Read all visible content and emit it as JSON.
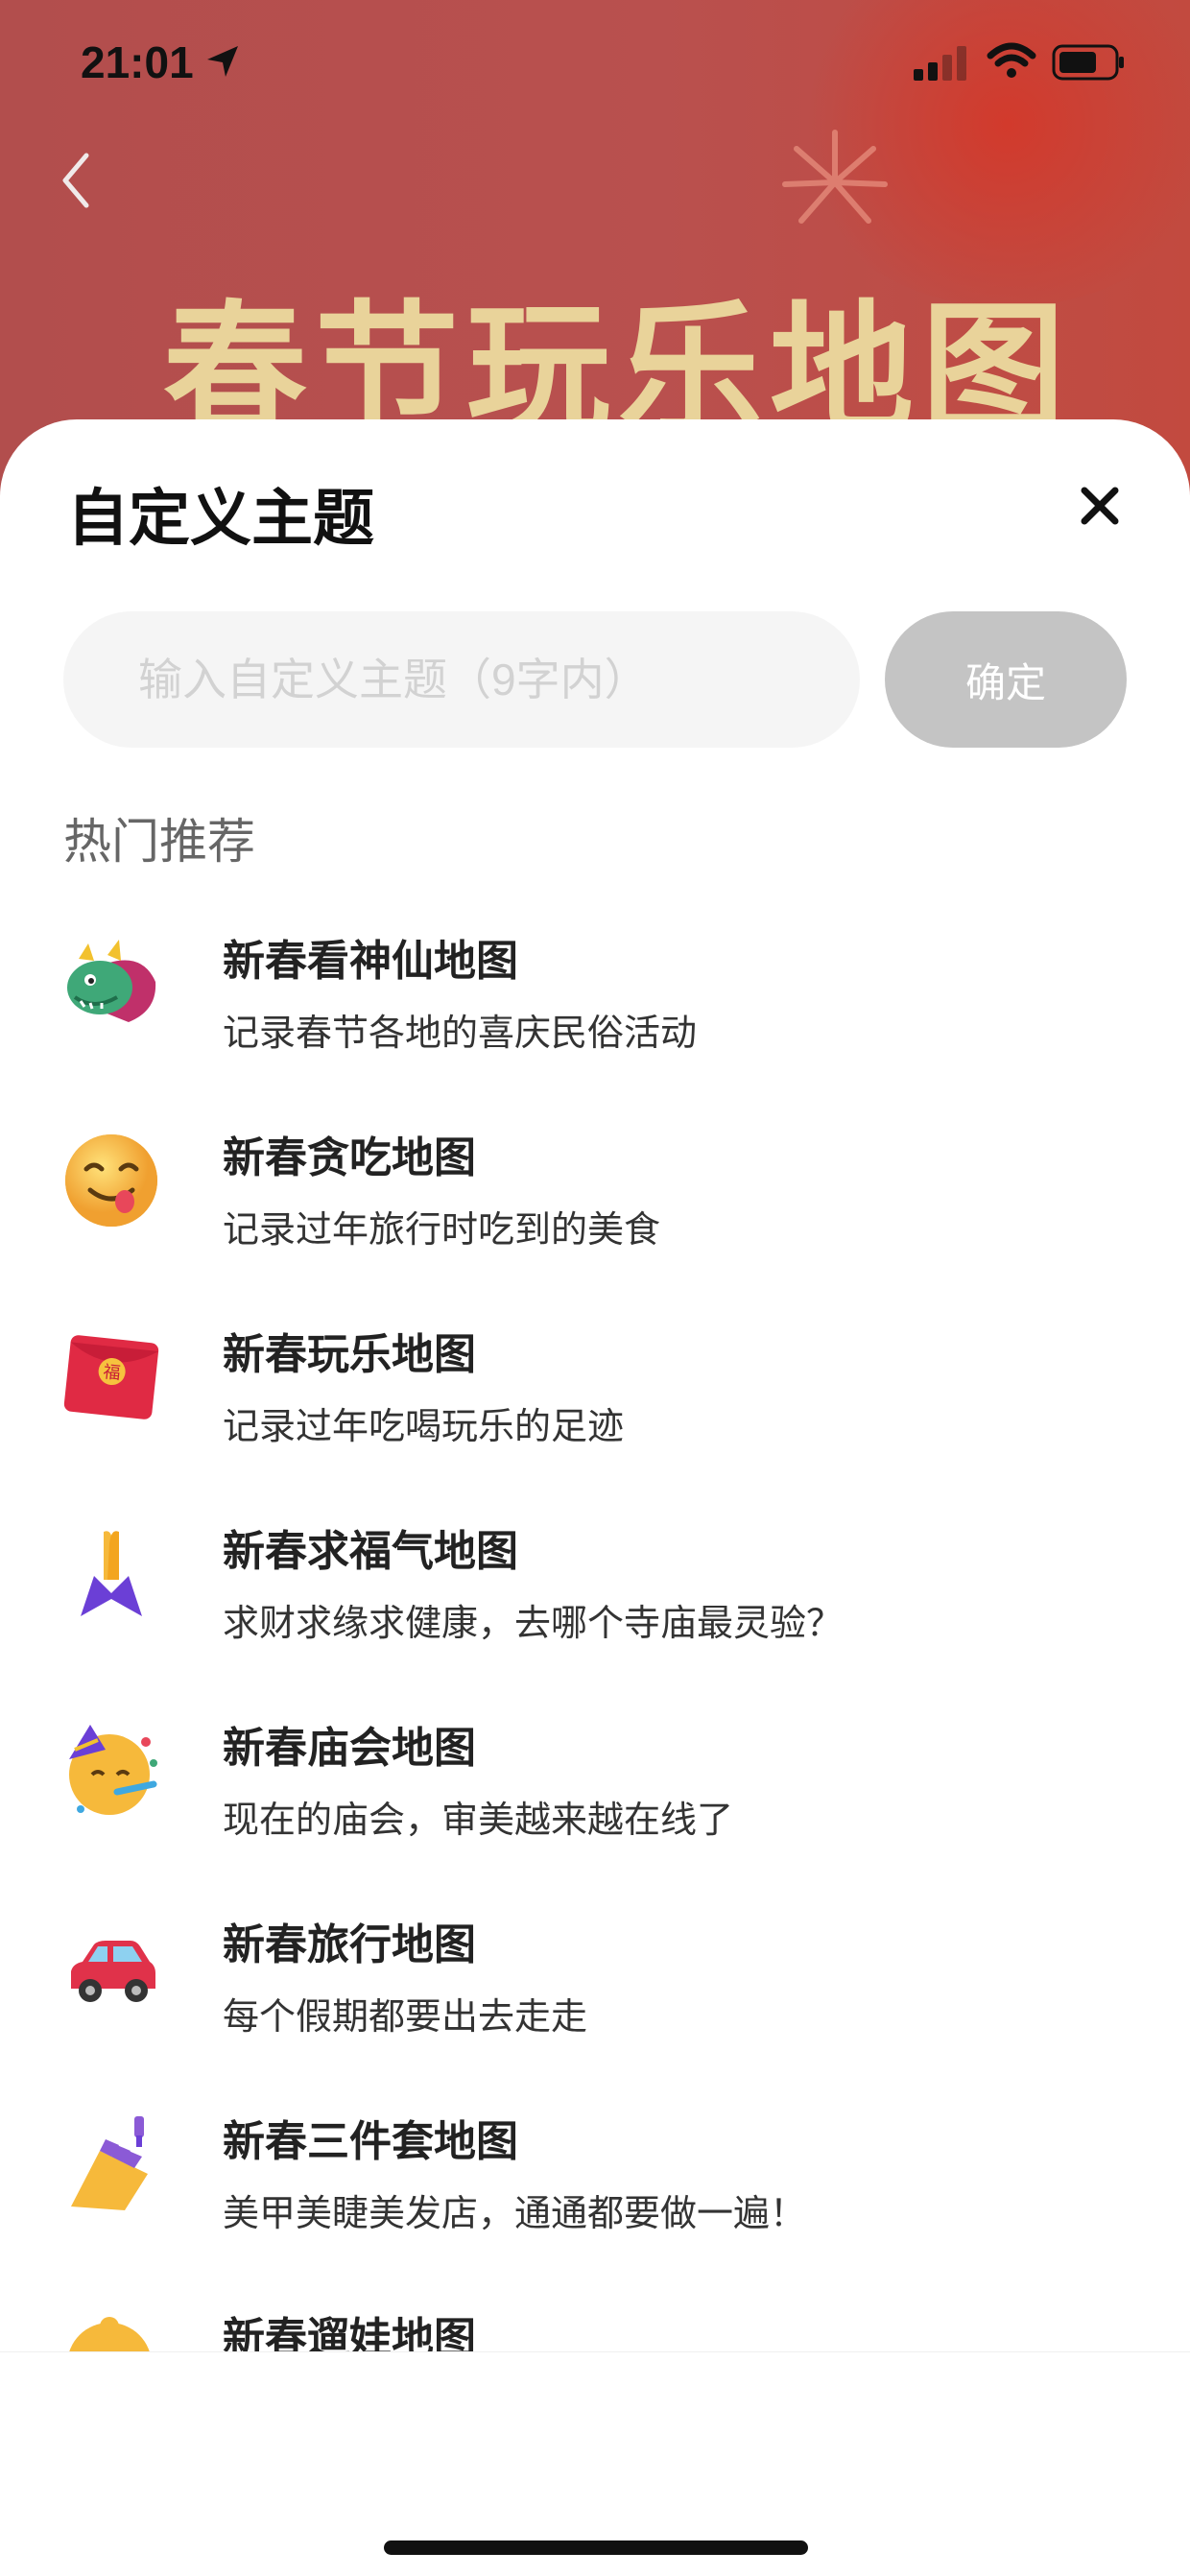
{
  "status_bar": {
    "time": "21:01"
  },
  "background": {
    "banner_title": "春节玩乐地图"
  },
  "sheet": {
    "title": "自定义主题",
    "input": {
      "placeholder": "输入自定义主题（9字内）",
      "value": ""
    },
    "confirm_label": "确定",
    "section_title": "热门推荐",
    "items": [
      {
        "title": "新春看神仙地图",
        "subtitle": "记录春节各地的喜庆民俗活动",
        "icon": "dragon-icon"
      },
      {
        "title": "新春贪吃地图",
        "subtitle": "记录过年旅行时吃到的美食",
        "icon": "yum-face-icon"
      },
      {
        "title": "新春玩乐地图",
        "subtitle": "记录过年吃喝玩乐的足迹",
        "icon": "red-envelope-icon",
        "icon_text": "福"
      },
      {
        "title": "新春求福气地图",
        "subtitle": "求财求缘求健康，去哪个寺庙最灵验？",
        "icon": "praying-hands-icon"
      },
      {
        "title": "新春庙会地图",
        "subtitle": "现在的庙会，审美越来越在线了",
        "icon": "party-face-icon"
      },
      {
        "title": "新春旅行地图",
        "subtitle": "每个假期都要出去走走",
        "icon": "car-icon"
      },
      {
        "title": "新春三件套地图",
        "subtitle": "美甲美睫美发店，通通都要做一遍！",
        "icon": "nail-polish-icon"
      },
      {
        "title": "新春遛娃地图",
        "subtitle": "",
        "icon": "baby-icon"
      }
    ]
  }
}
